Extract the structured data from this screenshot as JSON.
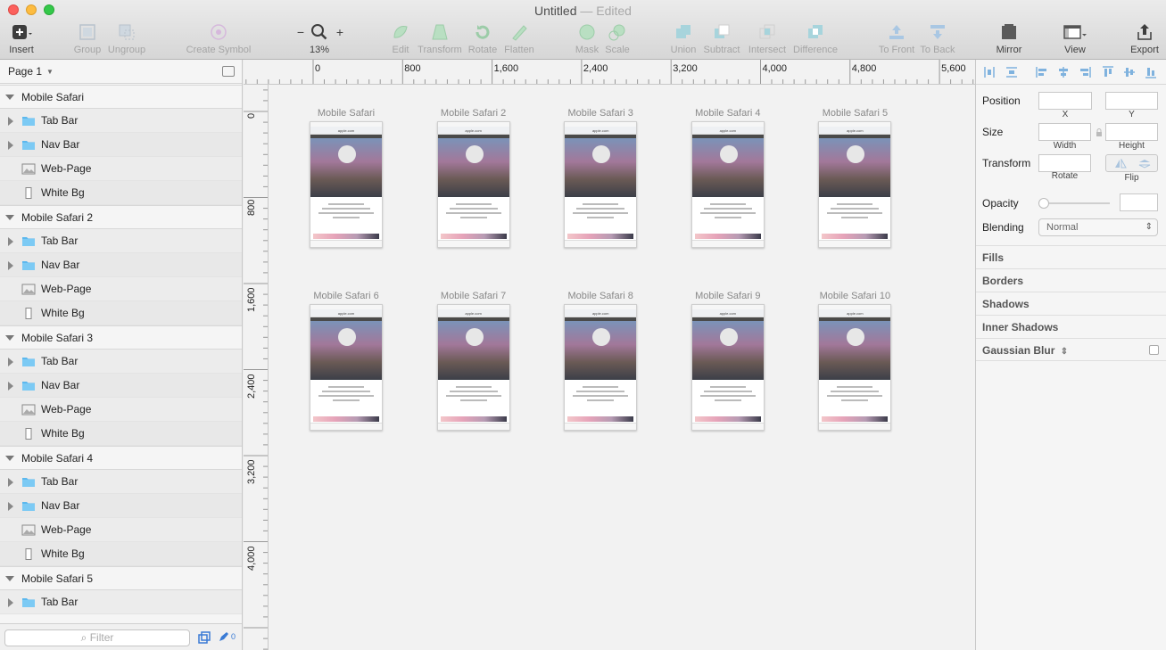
{
  "window": {
    "title": "Untitled",
    "status": "— Edited"
  },
  "toolbar": {
    "insert": "Insert",
    "group": "Group",
    "ungroup": "Ungroup",
    "create_symbol": "Create Symbol",
    "zoom_minus": "−",
    "zoom_plus": "+",
    "zoom_level": "13%",
    "edit": "Edit",
    "transform": "Transform",
    "rotate": "Rotate",
    "flatten": "Flatten",
    "mask": "Mask",
    "scale": "Scale",
    "union": "Union",
    "subtract": "Subtract",
    "intersect": "Intersect",
    "difference": "Difference",
    "to_front": "To Front",
    "to_back": "To Back",
    "mirror": "Mirror",
    "view": "View",
    "export": "Export"
  },
  "sidebar": {
    "page": "Page 1",
    "groups": [
      {
        "name": "Mobile Safari",
        "children": [
          "Tab Bar",
          "Nav Bar",
          "Web-Page",
          "White Bg"
        ]
      },
      {
        "name": "Mobile Safari 2",
        "children": [
          "Tab Bar",
          "Nav Bar",
          "Web-Page",
          "White Bg"
        ]
      },
      {
        "name": "Mobile Safari 3",
        "children": [
          "Tab Bar",
          "Nav Bar",
          "Web-Page",
          "White Bg"
        ]
      },
      {
        "name": "Mobile Safari 4",
        "children": [
          "Tab Bar",
          "Nav Bar",
          "Web-Page",
          "White Bg"
        ]
      },
      {
        "name": "Mobile Safari 5",
        "children": [
          "Tab Bar"
        ]
      }
    ],
    "filter_placeholder": "Filter",
    "edit_count": "0"
  },
  "rulers": {
    "top": [
      "0",
      "800",
      "1,600",
      "2,400",
      "3,200",
      "4,000",
      "4,800",
      "5,600"
    ],
    "left": [
      "0",
      "800",
      "1,600",
      "2,400",
      "3,200",
      "4,000"
    ]
  },
  "artboards": [
    {
      "title": "Mobile Safari",
      "url": "apple.com"
    },
    {
      "title": "Mobile Safari 2",
      "url": "apple.com"
    },
    {
      "title": "Mobile Safari 3",
      "url": "apple.com"
    },
    {
      "title": "Mobile Safari 4",
      "url": "apple.com"
    },
    {
      "title": "Mobile Safari 5",
      "url": "apple.com"
    },
    {
      "title": "Mobile Safari 6",
      "url": "apple.com"
    },
    {
      "title": "Mobile Safari 7",
      "url": "apple.com"
    },
    {
      "title": "Mobile Safari 8",
      "url": "apple.com"
    },
    {
      "title": "Mobile Safari 9",
      "url": "apple.com"
    },
    {
      "title": "Mobile Safari 10",
      "url": "apple.com"
    }
  ],
  "inspector": {
    "position": "Position",
    "x": "X",
    "y": "Y",
    "size": "Size",
    "width": "Width",
    "height": "Height",
    "transform": "Transform",
    "rotate": "Rotate",
    "flip": "Flip",
    "opacity": "Opacity",
    "blending": "Blending",
    "blending_value": "Normal",
    "fills": "Fills",
    "borders": "Borders",
    "shadows": "Shadows",
    "inner_shadows": "Inner Shadows",
    "gaussian_blur": "Gaussian Blur"
  }
}
